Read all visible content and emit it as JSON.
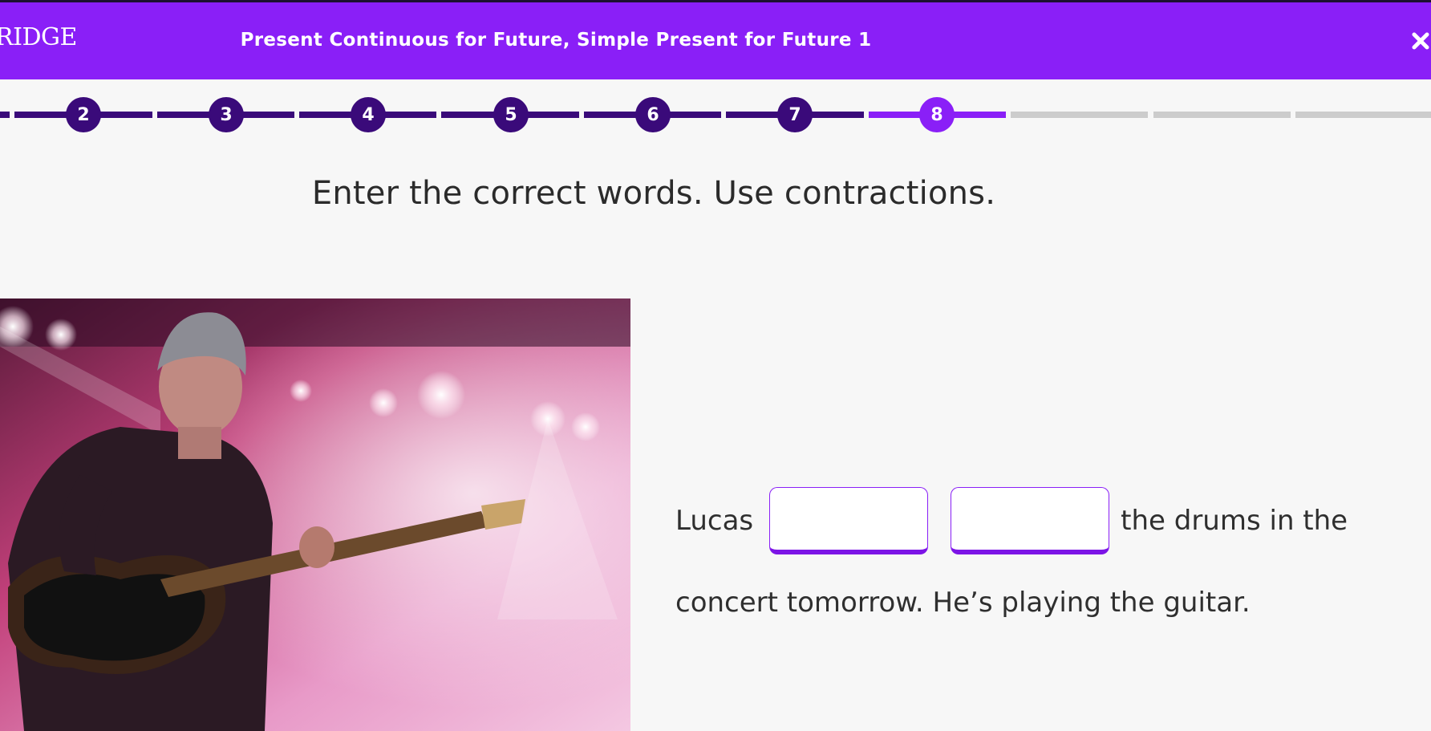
{
  "header": {
    "logo_text": "RIDGE",
    "title": "Present Continuous for Future, Simple Present for Future 1"
  },
  "progress": {
    "steps": [
      "2",
      "3",
      "4",
      "5",
      "6",
      "7",
      "8"
    ],
    "current_step": "8"
  },
  "instruction": "Enter the correct words. Use contractions.",
  "exercise": {
    "before_text": "Lucas",
    "blank1_value": "",
    "blank2_value": "",
    "after_text": "the drums in the",
    "line2_text": "concert tomorrow. He’s playing the guitar."
  },
  "colors": {
    "brand_purple": "#8a1ff7",
    "completed_step": "#3a0a7a",
    "pending_step": "#cccccc"
  }
}
